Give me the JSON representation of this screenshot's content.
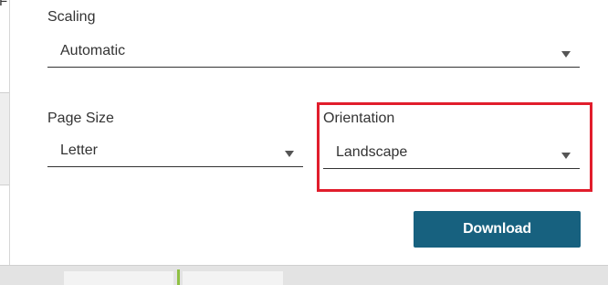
{
  "gutter": {
    "letter": "F"
  },
  "scaling": {
    "label": "Scaling",
    "value": "Automatic"
  },
  "page_size": {
    "label": "Page Size",
    "value": "Letter"
  },
  "orientation": {
    "label": "Orientation",
    "value": "Landscape"
  },
  "actions": {
    "download_label": "Download"
  },
  "colors": {
    "primary_button": "#17617f",
    "highlight_border": "#e11d2c",
    "underline": "#333333"
  },
  "icons": {
    "dropdown": "chevron-down-icon"
  }
}
